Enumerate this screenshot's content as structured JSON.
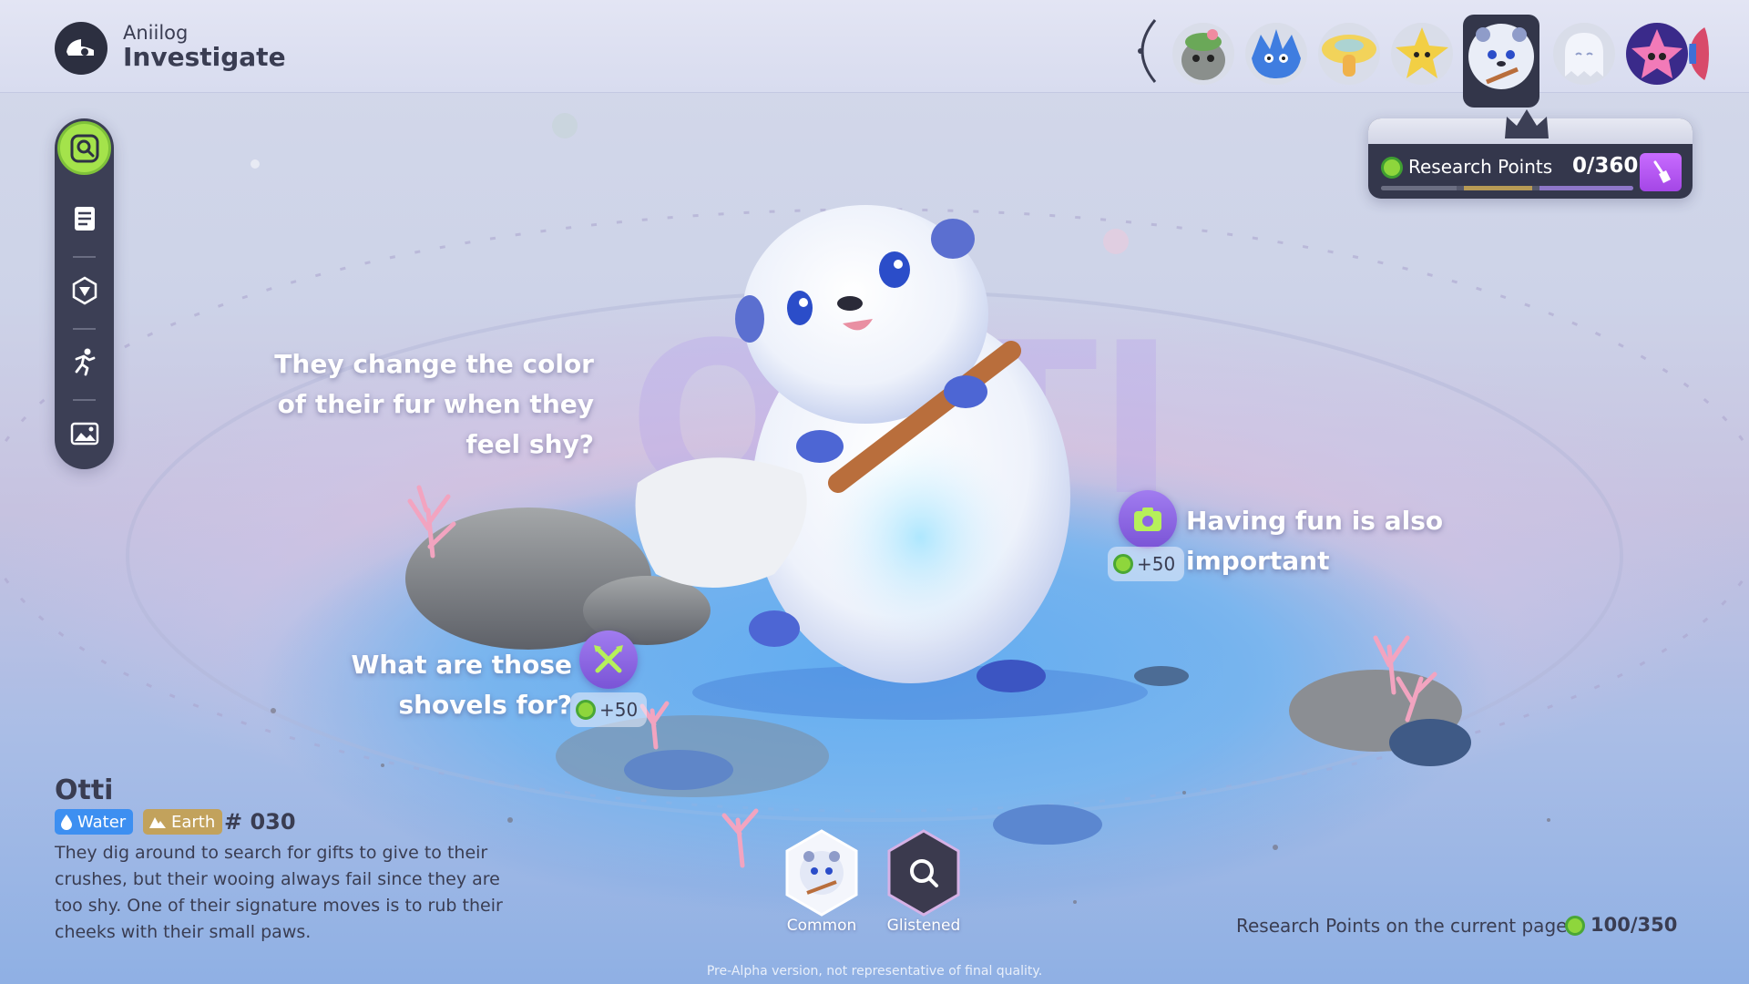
{
  "header": {
    "app_name": "Aniilog",
    "mode_title": "Investigate"
  },
  "creature_strip": {
    "items": [
      {
        "name": "creature-mossy-icon",
        "selected": false
      },
      {
        "name": "creature-blue-spiky-icon",
        "selected": false
      },
      {
        "name": "creature-yellow-mushroom-icon",
        "selected": false
      },
      {
        "name": "creature-yellow-star-icon",
        "selected": false
      },
      {
        "name": "creature-otti-icon",
        "selected": true
      },
      {
        "name": "creature-white-ghost-icon",
        "selected": false
      },
      {
        "name": "creature-pink-star-icon",
        "selected": false
      }
    ]
  },
  "sidebar": {
    "tools": [
      {
        "icon": "investigate-magnifier-icon",
        "active": true
      },
      {
        "icon": "notes-icon",
        "active": false
      },
      {
        "icon": "shield-badge-icon",
        "active": false
      },
      {
        "icon": "running-pose-icon",
        "active": false
      },
      {
        "icon": "gallery-image-icon",
        "active": false
      }
    ]
  },
  "research_points": {
    "label": "Research Points",
    "value": "0/360",
    "progress_fraction": 0.0
  },
  "prompts": {
    "fur_color": "They change the color of their fur when they feel shy?",
    "shovels": "What are those shovels for?",
    "shovels_reward": "+50",
    "having_fun": "Having fun is also important",
    "having_fun_reward": "+50"
  },
  "creature": {
    "name": "Otti",
    "types": [
      "Water",
      "Earth"
    ],
    "number": "# 030",
    "description": "They dig around to search for gifts to give to their crushes, but their wooing always fail since they are too shy. One of their signature moves is to rub their cheeks with their small paws."
  },
  "variants": {
    "common_label": "Common",
    "glistened_label": "Glistened"
  },
  "page_points": {
    "label": "Research Points on the current page:",
    "value": "100/350"
  },
  "footer": {
    "disclaimer": "Pre-Alpha version, not representative of final quality."
  },
  "colors": {
    "accent_green": "#a4e34b",
    "toolbar_dark": "#3c3f55",
    "badge_purple": "#8b66e2",
    "water_blue": "#3d8ff1",
    "earth_tan": "#c2a25c"
  }
}
